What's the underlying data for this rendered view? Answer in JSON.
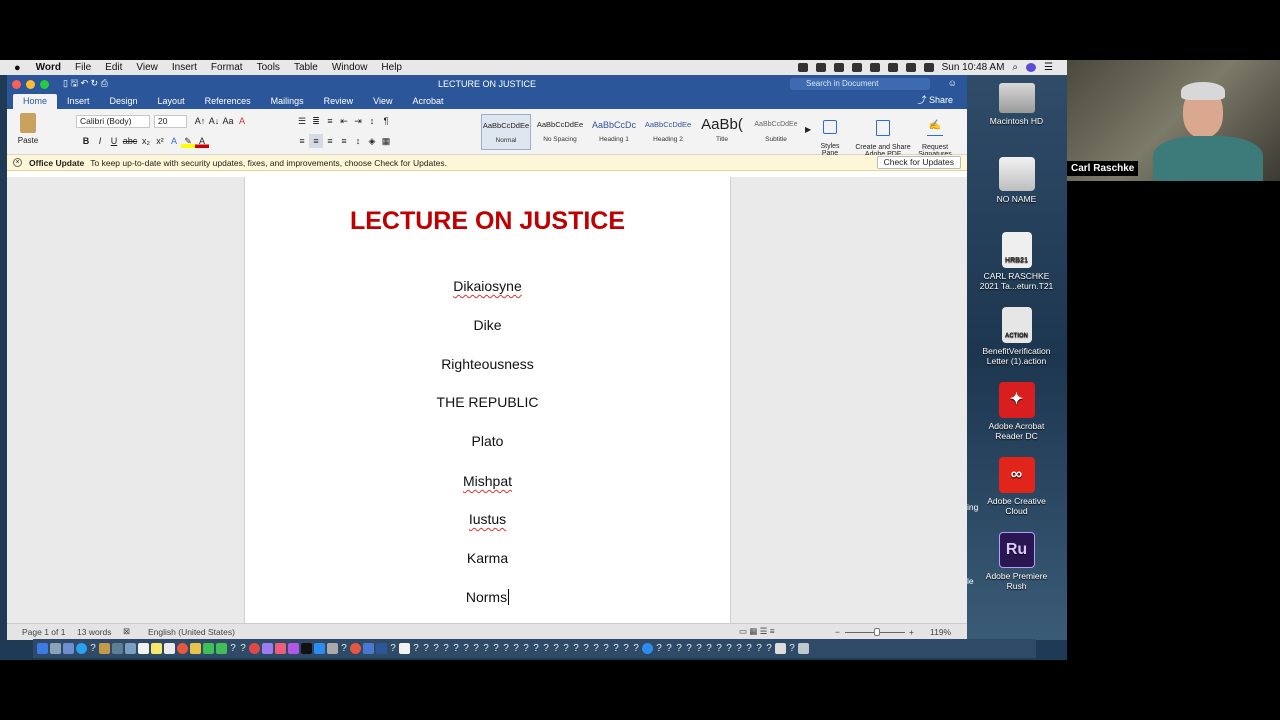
{
  "menubar": {
    "apple": "",
    "app_name": "Word",
    "items": [
      "File",
      "Edit",
      "View",
      "Insert",
      "Format",
      "Tools",
      "Table",
      "Window",
      "Help"
    ],
    "clock": "Sun 10:48 AM"
  },
  "window": {
    "title": "LECTURE ON JUSTICE",
    "search_placeholder": "Search in Document",
    "share_label": "Share"
  },
  "tabs": [
    "Home",
    "Insert",
    "Design",
    "Layout",
    "References",
    "Mailings",
    "Review",
    "View",
    "Acrobat"
  ],
  "ribbon": {
    "paste_label": "Paste",
    "font_name": "Calibri (Body)",
    "font_size": "20",
    "styles": [
      {
        "preview": "AaBbCcDdEe",
        "name": "Normal"
      },
      {
        "preview": "AaBbCcDdEe",
        "name": "No Spacing"
      },
      {
        "preview": "AaBbCcDc",
        "name": "Heading 1"
      },
      {
        "preview": "AaBbCcDdEe",
        "name": "Heading 2"
      },
      {
        "preview": "AaBb(",
        "name": "Title"
      },
      {
        "preview": "AaBbCcDdEe",
        "name": "Subtitle"
      }
    ],
    "styles_pane": "Styles\nPane",
    "create_pdf": "Create and Share\nAdobe PDF",
    "request_sig": "Request\nSignatures"
  },
  "notice": {
    "title": "Office Update",
    "text": "To keep up-to-date with security updates, fixes, and improvements, choose Check for Updates.",
    "button": "Check for Updates"
  },
  "document": {
    "title": "LECTURE ON JUSTICE",
    "lines": [
      "Dikaiosyne",
      "Dike",
      "Righteousness",
      "THE REPUBLIC",
      "Plato",
      "Mishpat",
      "Iustus",
      "Karma",
      "Norms"
    ]
  },
  "status": {
    "page": "Page 1 of 1",
    "words": "13 words",
    "language": "English (United States)",
    "zoom": "119%"
  },
  "desktop": [
    {
      "label": "Macintosh HD",
      "icon": "hard-drive-icon"
    },
    {
      "label": "NO NAME",
      "icon": "drive-icon"
    },
    {
      "label": "CARL RASCHKE\n2021 Ta...eturn.T21",
      "icon": "document-icon",
      "badge": "HRB21"
    },
    {
      "label": "BenefitVerification\nLetter (1).action",
      "icon": "action-icon",
      "badge": "ACTION"
    },
    {
      "label": "Adobe Acrobat\nReader DC",
      "icon": "acrobat-icon"
    },
    {
      "label": "Adobe Creative\nCloud",
      "icon": "creative-cloud-icon"
    },
    {
      "label": "Adobe Premiere\nRush",
      "icon": "premiere-rush-icon",
      "badge": "Ru"
    }
  ],
  "desktop_edge_labels": [
    "ing",
    "le"
  ],
  "webcam": {
    "name": "Carl Raschke"
  },
  "colors": {
    "word_blue": "#2b579a",
    "title_red": "#c00000"
  }
}
